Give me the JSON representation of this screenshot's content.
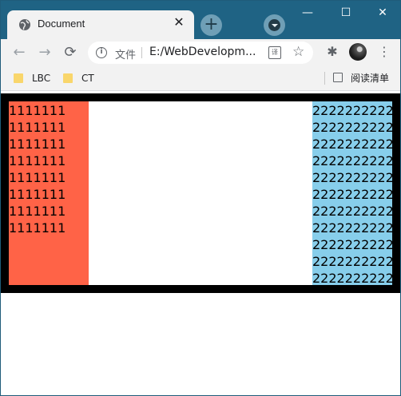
{
  "tab": {
    "title": "Document",
    "icon": "globe-icon",
    "close_label": "✕"
  },
  "new_tab": {
    "label": "+"
  },
  "window_controls": {
    "minimize": "—",
    "maximize": "☐",
    "close": "✕"
  },
  "toolbar": {
    "back_label": "←",
    "forward_label": "→",
    "reload_label": "⟳",
    "info_label": "i",
    "scheme_label": "文件",
    "url": "E:/WebDevelopm...",
    "translate_label": "译",
    "star_label": "☆",
    "extensions_label": "✱",
    "menu_label": "⋮"
  },
  "bookmarks": {
    "items": [
      {
        "label": "LBC"
      },
      {
        "label": "CT"
      }
    ],
    "reading_list": "阅读清单"
  },
  "page": {
    "left_lines": [
      "1111111",
      "1111111",
      "1111111",
      "1111111",
      "1111111",
      "1111111",
      "1111111",
      "1111111"
    ],
    "right_lines": [
      "2222222222",
      "2222222222",
      "2222222222",
      "2222222222",
      "2222222222",
      "2222222222",
      "2222222222",
      "2222222222",
      "2222222222",
      "2222222222",
      "2222222222"
    ],
    "colors": {
      "outer": "#000000",
      "left": "#ff6347",
      "right": "#87ceeb",
      "inner": "#ffffff"
    }
  }
}
